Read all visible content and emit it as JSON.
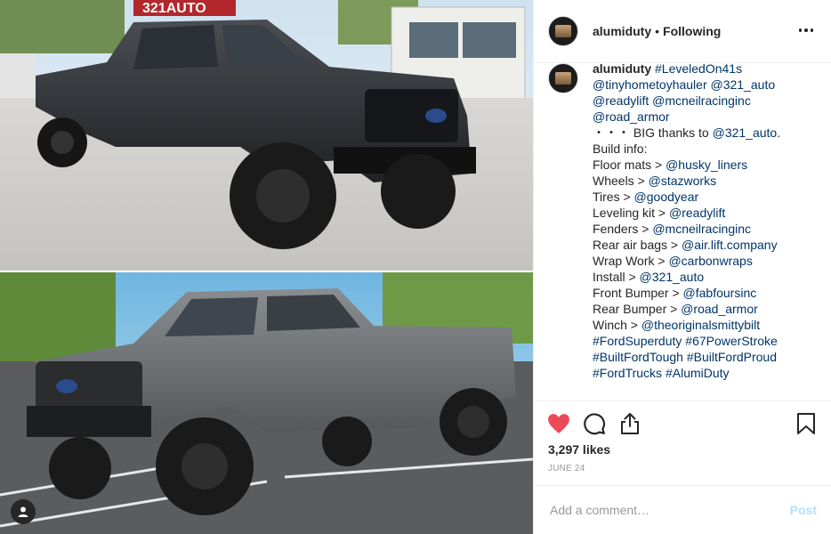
{
  "header": {
    "username": "alumiduty",
    "separator": "•",
    "follow_status": "Following"
  },
  "caption": {
    "username": "alumiduty",
    "lines": [
      [
        {
          "t": "#LeveledOn41s",
          "link": true
        }
      ],
      [
        {
          "t": "@tinyhometoyhauler",
          "link": true
        },
        {
          "t": " "
        },
        {
          "t": "@321_auto",
          "link": true
        }
      ],
      [
        {
          "t": "@readylift",
          "link": true
        },
        {
          "t": " "
        },
        {
          "t": "@mcneilracinginc",
          "link": true
        }
      ],
      [
        {
          "t": "@road_armor",
          "link": true
        }
      ],
      [
        {
          "t": "・・・ BIG thanks to "
        },
        {
          "t": "@321_auto",
          "link": true
        },
        {
          "t": "."
        }
      ],
      [
        {
          "t": "Build info:"
        }
      ],
      [
        {
          "t": "Floor mats > "
        },
        {
          "t": "@husky_liners",
          "link": true
        }
      ],
      [
        {
          "t": "Wheels > "
        },
        {
          "t": "@stazworks",
          "link": true
        }
      ],
      [
        {
          "t": "Tires > "
        },
        {
          "t": "@goodyear",
          "link": true
        }
      ],
      [
        {
          "t": "Leveling kit > "
        },
        {
          "t": "@readylift",
          "link": true
        }
      ],
      [
        {
          "t": "Fenders > "
        },
        {
          "t": "@mcneilracinginc",
          "link": true
        }
      ],
      [
        {
          "t": "Rear air bags > "
        },
        {
          "t": "@air.lift.company",
          "link": true
        }
      ],
      [
        {
          "t": "Wrap Work > "
        },
        {
          "t": "@carbonwraps",
          "link": true
        }
      ],
      [
        {
          "t": "Install > "
        },
        {
          "t": "@321_auto",
          "link": true
        }
      ],
      [
        {
          "t": "Front Bumper > "
        },
        {
          "t": "@fabfoursinc",
          "link": true
        }
      ],
      [
        {
          "t": "Rear Bumper > "
        },
        {
          "t": "@road_armor",
          "link": true
        }
      ],
      [
        {
          "t": "Winch > "
        },
        {
          "t": "@theoriginalsmittybilt",
          "link": true
        }
      ],
      [
        {
          "t": "#FordSuperduty",
          "link": true
        },
        {
          "t": " "
        },
        {
          "t": "#67PowerStroke",
          "link": true
        }
      ],
      [
        {
          "t": "#BuiltFordTough",
          "link": true
        },
        {
          "t": " "
        },
        {
          "t": "#BuiltFordProud",
          "link": true
        }
      ],
      [
        {
          "t": "#FordTrucks",
          "link": true
        },
        {
          "t": " "
        },
        {
          "t": "#AlumiDuty",
          "link": true
        }
      ]
    ],
    "trailing": "."
  },
  "stats": {
    "likes": "3,297 likes",
    "date": "JUNE 24"
  },
  "comment_box": {
    "placeholder": "Add a comment…",
    "post_label": "Post"
  },
  "photo_sign": {
    "top": "321AUTO"
  },
  "icons": {
    "like": "heart-icon",
    "comment": "comment-icon",
    "share": "share-icon",
    "save": "bookmark-icon",
    "more": "more-options-icon",
    "tag": "user-tag-icon"
  },
  "colors": {
    "like": "#ed4956",
    "link": "#003569",
    "post": "#b2dffc",
    "muted": "#999999"
  }
}
